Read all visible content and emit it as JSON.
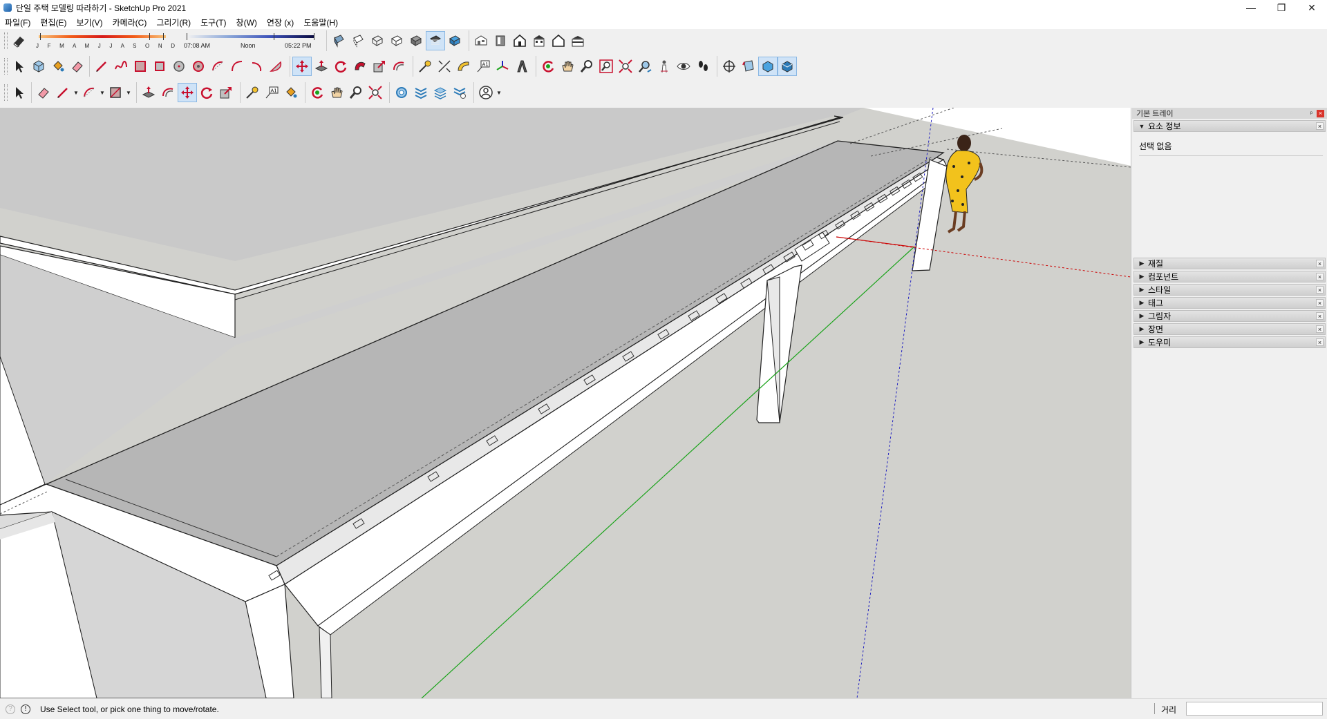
{
  "window": {
    "title": "단일 주택 모델링 따라하기 - SketchUp Pro 2021",
    "controls": [
      "—",
      "❐",
      "✕"
    ]
  },
  "menu": [
    "파일(F)",
    "편집(E)",
    "보기(V)",
    "카메라(C)",
    "그리기(R)",
    "도구(T)",
    "창(W)",
    "연장 (x)",
    "도움말(H)"
  ],
  "shadow": {
    "months": "J F M A M J J A S O N D",
    "time_start": "07:08 AM",
    "time_mid": "Noon",
    "time_end": "05:22 PM"
  },
  "tray": {
    "title": "기본 트레이",
    "pin": "ᵖ",
    "close": "×",
    "entity_info": {
      "label": "요소 정보",
      "expanded_arrow": "▼",
      "content": "선택 없음"
    },
    "collapsed_arrow": "▶",
    "panels": [
      "재질",
      "컴포넌트",
      "스타일",
      "태그",
      "그림자",
      "장면",
      "도우미"
    ]
  },
  "status": {
    "message": "Use Select tool, or pick one thing to move/rotate.",
    "measure_label": "거리",
    "measure_value": ""
  },
  "colors": {
    "accent": "#cfe3f7",
    "close_red": "#d9342b",
    "sky": "#ffffff",
    "ground": "#d0d0cc",
    "slab_top": "#b6b6b6",
    "axis_red": "#cc0000",
    "axis_green": "#1aa31a",
    "axis_blue": "#2020c0"
  }
}
